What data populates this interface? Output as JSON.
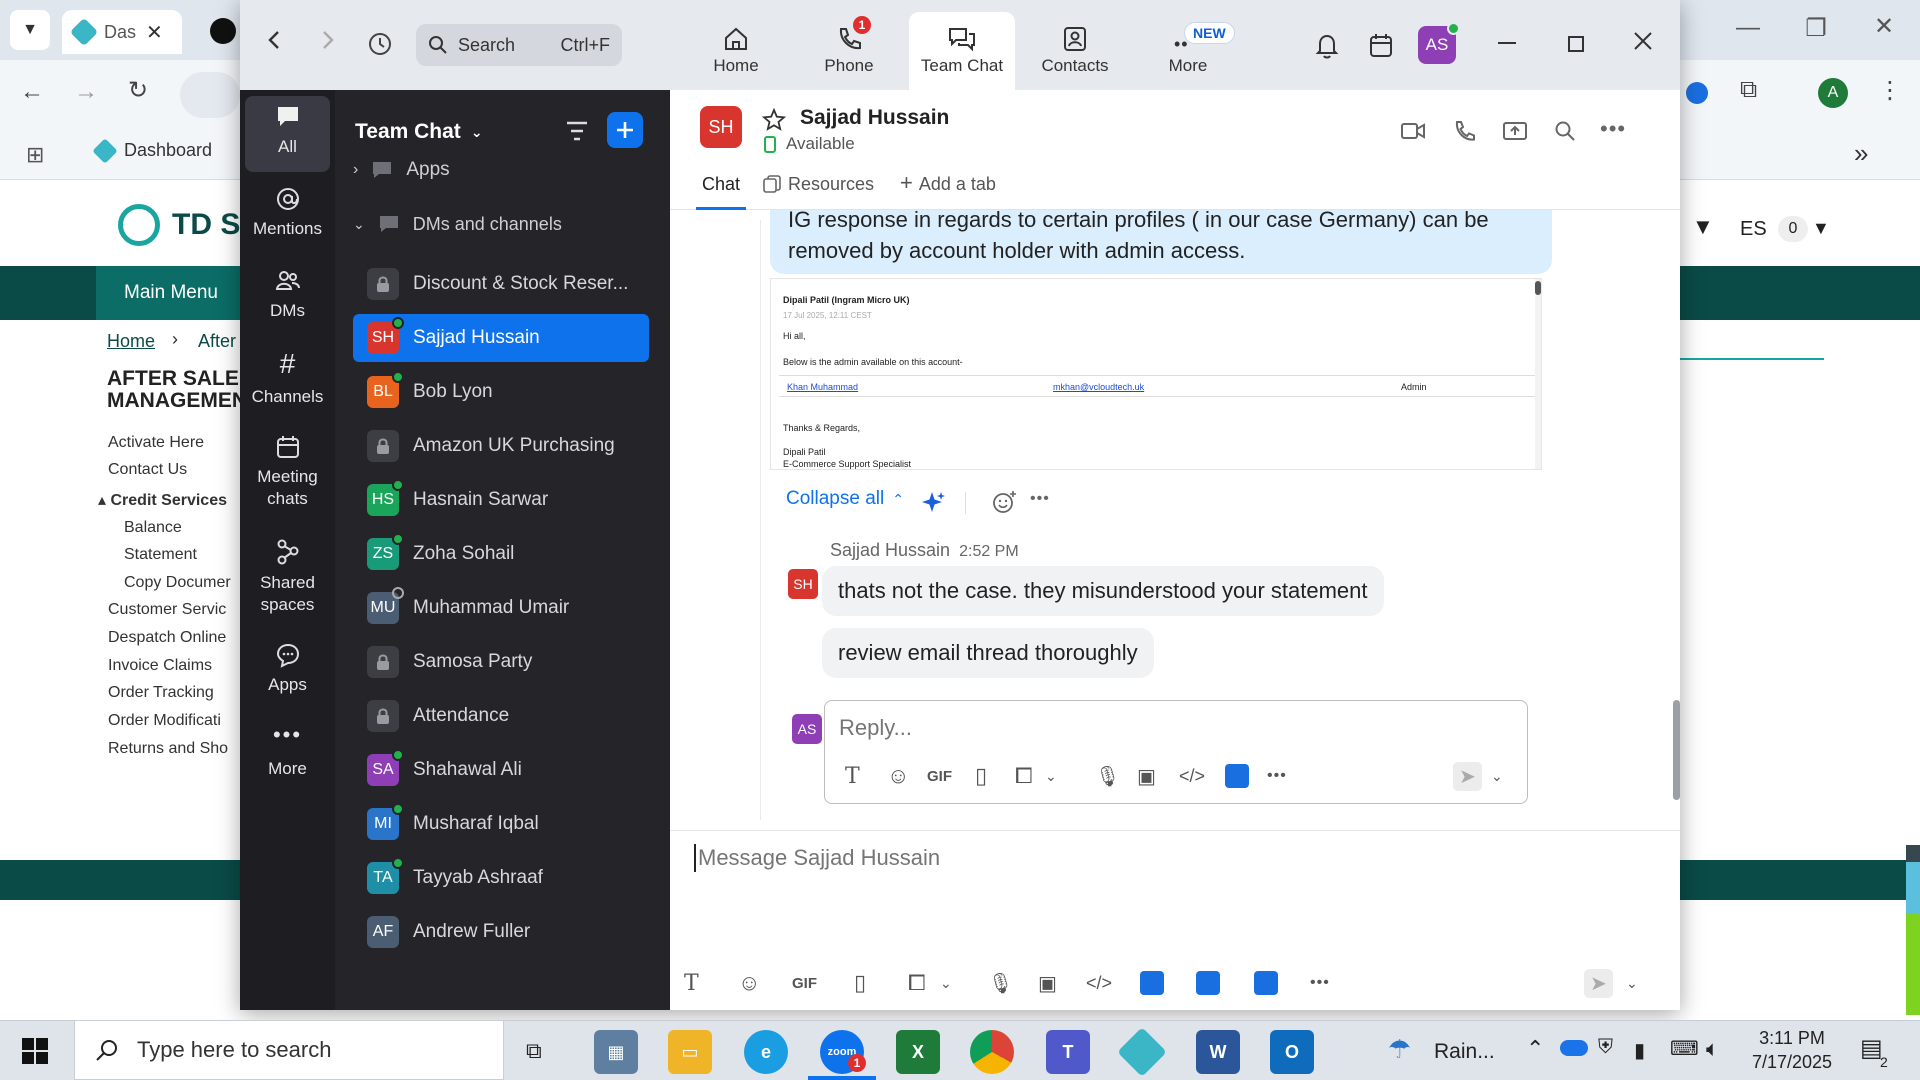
{
  "browser": {
    "tab1_title": "Das",
    "bookmark_dashboard": "Dashboard",
    "profile_initial": "A"
  },
  "site": {
    "logo_text": "TD SY",
    "main_menu": "Main Menu",
    "breadcrumb_home": "Home",
    "breadcrumb_after": "After",
    "section_title_line1": "AFTER SALE",
    "section_title_line2": "MANAGEMEN",
    "links": [
      "Activate Here",
      "Contact Us"
    ],
    "credit_services": "Credit Services",
    "credit_sub": [
      "Balance",
      "Statement",
      "Copy Documer"
    ],
    "more_links": [
      "Customer Servic",
      "Despatch Online",
      "Invoice Claims",
      "Order Tracking",
      "Order Modificati",
      "Returns and Sho"
    ],
    "lang": "ES",
    "lang_count": "0"
  },
  "zoom": {
    "search_label": "Search",
    "search_shortcut": "Ctrl+F",
    "nav": [
      {
        "label": "Home"
      },
      {
        "label": "Phone",
        "badge": "1"
      },
      {
        "label": "Team Chat"
      },
      {
        "label": "Contacts"
      },
      {
        "label": "More",
        "badge": "NEW"
      }
    ],
    "user_avatar": "AS",
    "rail": [
      {
        "label": "All"
      },
      {
        "label": "Mentions"
      },
      {
        "label": "DMs"
      },
      {
        "label": "Channels"
      },
      {
        "label": "Meeting chats"
      },
      {
        "label": "Shared spaces"
      },
      {
        "label": "Apps"
      },
      {
        "label": "More"
      }
    ],
    "sidebar": {
      "title": "Team Chat",
      "apps_label": "Apps",
      "dms_label": "DMs and channels",
      "items": [
        {
          "name": "Discount & Stock Reser...",
          "type": "channel"
        },
        {
          "name": "Sajjad Hussain",
          "initials": "SH",
          "color": "#d9352f",
          "status": "online",
          "selected": true
        },
        {
          "name": "Bob Lyon",
          "initials": "BL",
          "color": "#e8641e",
          "status": "online"
        },
        {
          "name": "Amazon UK Purchasing",
          "type": "channel"
        },
        {
          "name": "Hasnain Sarwar",
          "initials": "HS",
          "color": "#1aa55a",
          "status": "online"
        },
        {
          "name": "Zoha Sohail",
          "initials": "ZS",
          "color": "#199a78",
          "status": "online"
        },
        {
          "name": "Muhammad Umair",
          "initials": "MU",
          "color": "#4a5d73",
          "status": "away"
        },
        {
          "name": "Samosa Party",
          "type": "channel"
        },
        {
          "name": "Attendance",
          "type": "channel"
        },
        {
          "name": "Shahawal Ali",
          "initials": "SA",
          "color": "#8e3fb5",
          "status": "online"
        },
        {
          "name": "Musharaf Iqbal",
          "initials": "MI",
          "color": "#2a74c9",
          "status": "online"
        },
        {
          "name": "Tayyab Ashraaf",
          "initials": "TA",
          "color": "#1f8fa8",
          "status": "online"
        },
        {
          "name": "Andrew Fuller",
          "initials": "AF",
          "color": "#4a5d73",
          "status": "none"
        }
      ]
    },
    "chat": {
      "contact_initials": "SH",
      "contact_name": "Sajjad Hussain",
      "contact_status": "Available",
      "tabs": [
        "Chat",
        "Resources",
        "Add a tab"
      ],
      "message_text": "IG response in regards to certain profiles ( in our case Germany) can be removed by account holder with admin access.",
      "email": {
        "from": "Dipali Patil (Ingram Micro UK)",
        "date": "17 Jul 2025, 12:11 CEST",
        "greeting": "Hi all,",
        "body": "Below is the admin available on this account-",
        "table_name": "Khan Muhammad",
        "table_email": "mkhan@vcloudtech.uk",
        "table_role": "Admin",
        "signoff": "Thanks & Regards,",
        "sig_name": "Dipali Patil",
        "sig_title": "E-Commerce Support Specialist"
      },
      "collapse_label": "Collapse all",
      "reply_sender": "Sajjad Hussain",
      "reply_time": "2:52 PM",
      "reply_messages": [
        "thats not the case. they misunderstood your statement",
        "review email thread thoroughly"
      ],
      "reply_avatar": "AS",
      "reply_placeholder": "Reply...",
      "composer_placeholder": "Message Sajjad Hussain",
      "gif_label": "GIF"
    }
  },
  "taskbar": {
    "search_placeholder": "Type here to search",
    "weather": "Rain...",
    "time": "3:11 PM",
    "date": "7/17/2025",
    "notif_count": "2",
    "zoom_badge": "1"
  }
}
